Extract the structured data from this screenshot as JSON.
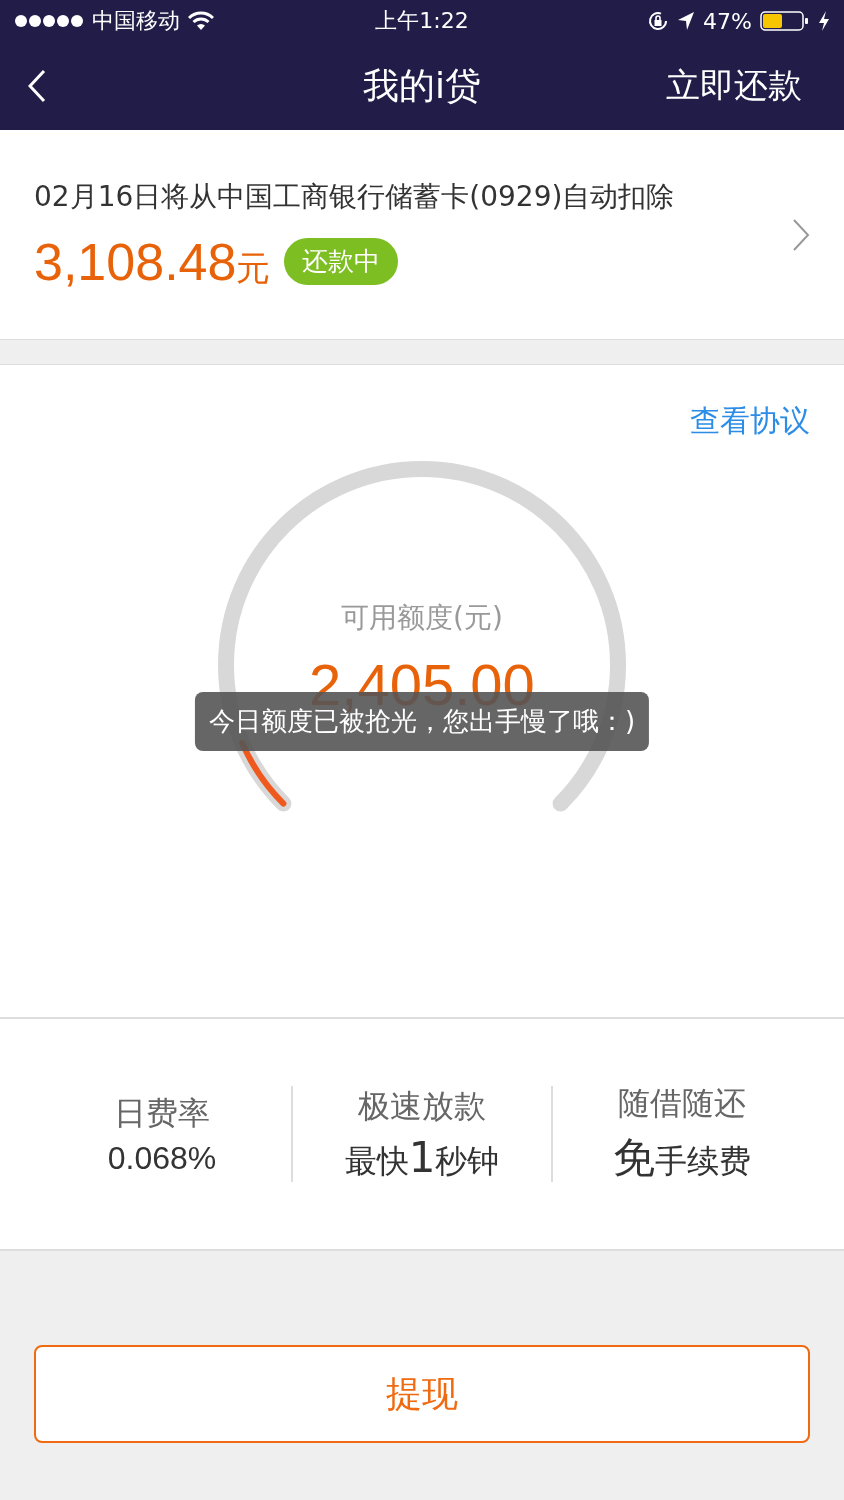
{
  "status_bar": {
    "carrier": "中国移动",
    "time": "上午1:22",
    "battery": "47%"
  },
  "nav": {
    "title": "我的i贷",
    "action": "立即还款"
  },
  "repayment": {
    "notice": "02月16日将从中国工商银行储蓄卡(0929)自动扣除",
    "amount": "3,108.48",
    "unit": "元",
    "status": "还款中"
  },
  "credit": {
    "agreement_link": "查看协议",
    "label": "可用额度(元)",
    "amount": "2,405.00",
    "level": 0.08,
    "toast": "今日额度已被抢光，您出手慢了哦：)"
  },
  "features": [
    {
      "title": "日费率",
      "value": [
        {
          "text": "0.068%",
          "large": false
        }
      ]
    },
    {
      "title": "极速放款",
      "value": [
        {
          "text": "最快",
          "large": false
        },
        {
          "text": "1",
          "large": true
        },
        {
          "text": "秒钟",
          "large": false
        }
      ]
    },
    {
      "title": "随借随还",
      "value": [
        {
          "text": "免",
          "large": true
        },
        {
          "text": "手续费",
          "large": false
        }
      ]
    }
  ],
  "withdraw_button": "提现"
}
